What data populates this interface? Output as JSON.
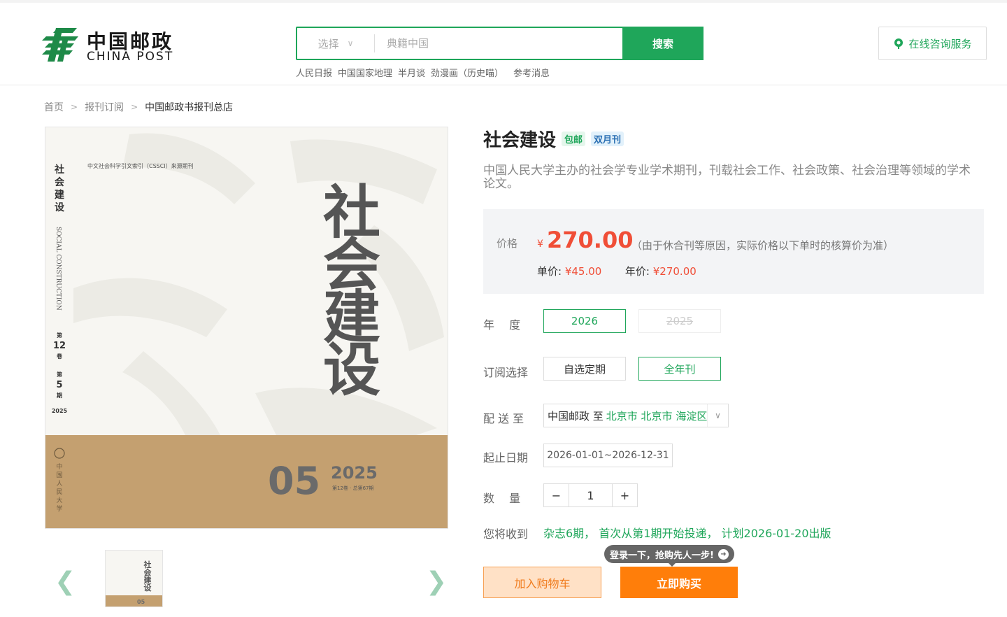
{
  "header": {
    "logo_cn": "中国邮政",
    "logo_en": "CHINA POST",
    "search": {
      "select_label": "选择",
      "placeholder": "典籍中国",
      "button_label": "搜索"
    },
    "hotwords": [
      "人民日报",
      "中国国家地理",
      "半月谈",
      "劲漫画（历史喵）",
      "参考消息"
    ],
    "consult_label": "在线咨询服务"
  },
  "breadcrumb": [
    "首页",
    "报刊订阅",
    "中国邮政书报刊总店"
  ],
  "cover": {
    "index_label": "中文社会科学引文索引（CSSCI）来源期刊",
    "spine_title": "社会建设",
    "spine_en": "SOCIAL CONSTRUCTION",
    "volume_1": "第",
    "volume_num": "12",
    "volume_2": "卷",
    "issue_1": "第",
    "issue_num": "5",
    "issue_2": "期",
    "year": "2025",
    "big_title_chars": [
      "社",
      "会",
      "建",
      "设"
    ],
    "issue_big": "05",
    "year_big": "2025",
    "vol_small": "第12卷 · 总第67期",
    "publisher": "中国人民大学"
  },
  "thumbs": {
    "prev": "❮",
    "next": "❯"
  },
  "product": {
    "title": "社会建设",
    "badge_free": "包邮",
    "badge_freq": "双月刊",
    "description": "中国人民大学主办的社会学专业学术期刊，刊载社会工作、社会政策、社会治理等领域的学术论文。",
    "price_label": "价格",
    "currency": "¥",
    "price": "270.00",
    "price_note": "（由于休合刊等原因，实际价格以下单时的核算价为准）",
    "unit_price_label": "单价:",
    "unit_price": "¥45.00",
    "year_price_label": "年价:",
    "year_price": "¥270.00",
    "year_label": "年　 度",
    "years": [
      "2026",
      "2025"
    ],
    "sub_label": "订阅选择",
    "sub_options": [
      "自选定期",
      "全年刊"
    ],
    "ship_label": "配 送 至",
    "ship_carrier": "中国邮政 至",
    "ship_location": "北京市 北京市 海淀区",
    "date_label": "起止日期",
    "date_range": "2026-01-01~2026-12-31",
    "qty_label": "数　 量",
    "qty_minus": "−",
    "qty_value": "1",
    "qty_plus": "+",
    "receive_label": "您将收到",
    "receive_text": "杂志6期，  首次从第1期开始投递，  计划2026-01-20出版",
    "tip_text": "登录一下，抢购先人一步!",
    "cart_label": "加入购物车",
    "buy_label": "立即购买"
  },
  "colors": {
    "brand_green": "#1fa65a",
    "price_red": "#f04e37",
    "buy_orange": "#ff7e0a",
    "cover_band": "#c4a070"
  }
}
